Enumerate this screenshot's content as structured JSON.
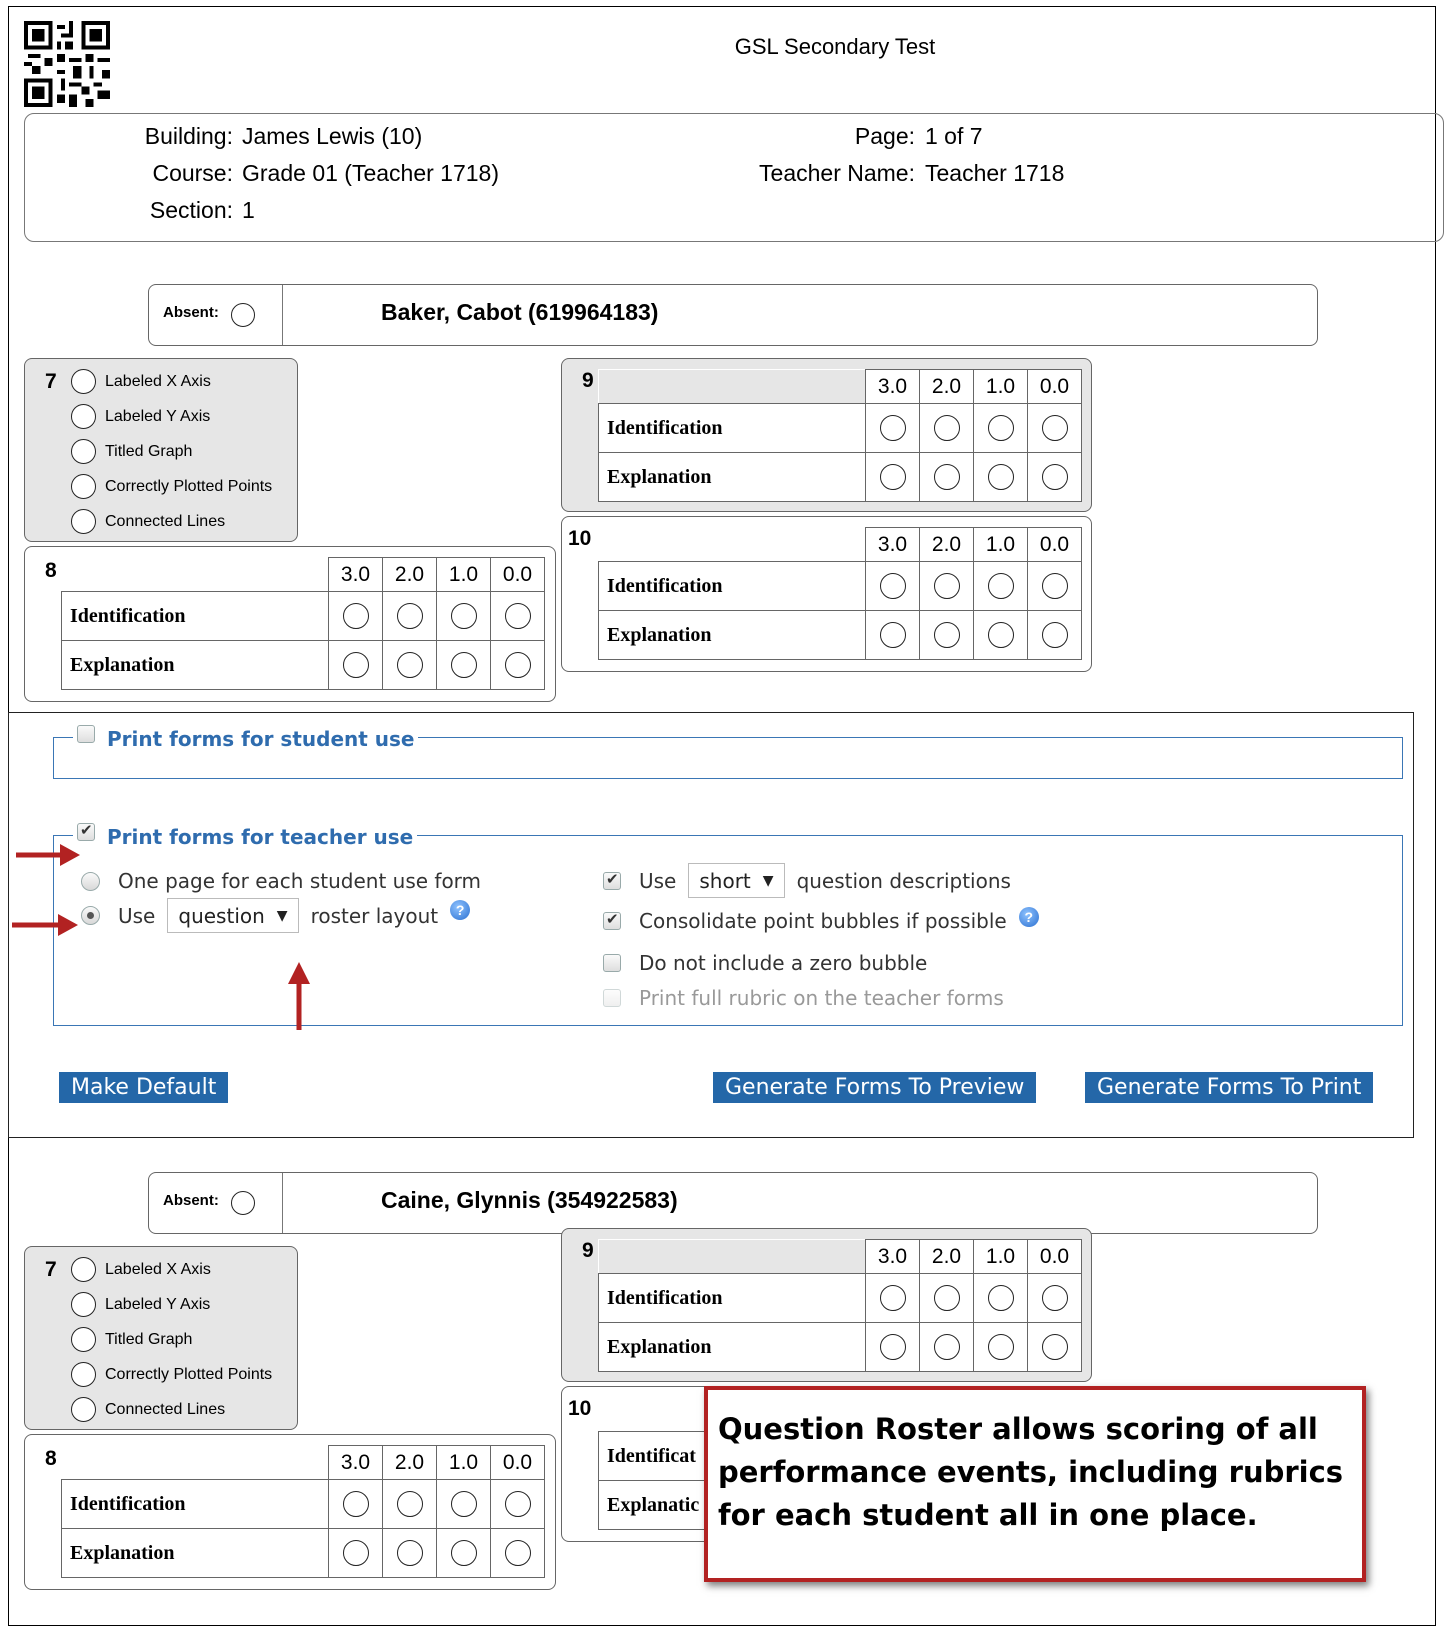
{
  "header": {
    "title": "GSL Secondary Test",
    "building_label": "Building:",
    "building_value": "James Lewis (10)",
    "course_label": "Course:",
    "course_value": "Grade 01 (Teacher 1718)",
    "section_label": "Section:",
    "section_value": "1",
    "page_label": "Page:",
    "page_value": "1 of 7",
    "teacher_label": "Teacher Name:",
    "teacher_value": "Teacher 1718"
  },
  "rubric": {
    "scores": [
      "3.0",
      "2.0",
      "1.0",
      "0.0"
    ],
    "criteria": [
      "Identification",
      "Explanation"
    ],
    "q7_items": [
      "Labeled X Axis",
      "Labeled Y Axis",
      "Titled Graph",
      "Correctly Plotted Points",
      "Connected Lines"
    ],
    "q7": "7",
    "q8": "8",
    "q9": "9",
    "q10": "10",
    "q10_crit_partial": [
      "Identificat",
      "Explanatic"
    ]
  },
  "students": [
    {
      "absent_label": "Absent:",
      "name": "Baker, Cabot (619964183)"
    },
    {
      "absent_label": "Absent:",
      "name": "Caine, Glynnis (354922583)"
    }
  ],
  "options": {
    "student_use_label": "Print forms for student use",
    "student_use_checked": false,
    "teacher_use_label": "Print forms for teacher use",
    "teacher_use_checked": true,
    "one_page_label": "One page for each student use form",
    "use_label": "Use",
    "roster_select": "question",
    "roster_layout_label": "roster layout",
    "desc_use_label": "Use",
    "desc_select": "short",
    "desc_label": "question descriptions",
    "consolidate_label": "Consolidate point bubbles if possible",
    "zero_bubble_label": "Do not include a zero bubble",
    "full_rubric_label": "Print full rubric on the teacher forms",
    "help_glyph": "?"
  },
  "buttons": {
    "make_default": "Make Default",
    "preview": "Generate Forms To Preview",
    "print": "Generate Forms To Print"
  },
  "callout": {
    "text": "Question Roster allows scoring of all performance events, including rubrics for each student all in one place."
  },
  "colors": {
    "accent_blue": "#2f6cae",
    "button_blue": "#2467a8",
    "arrow_red": "#b22222",
    "panel_gray": "#e6e6e6"
  }
}
